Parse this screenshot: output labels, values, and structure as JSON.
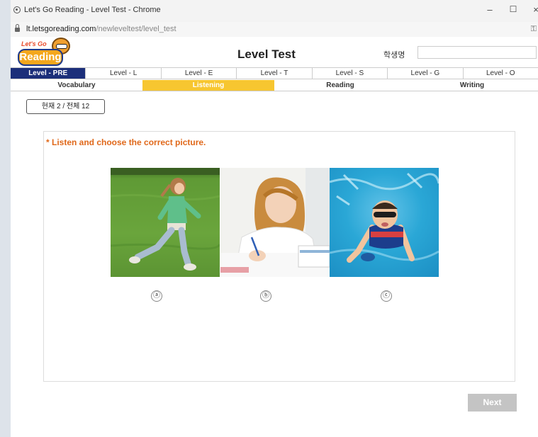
{
  "browser": {
    "window_title": "Let's Go Reading - Level Test - Chrome",
    "url_domain": "lt.letsgoreading.com",
    "url_path": "/newleveltest/level_test",
    "minimize": "–",
    "maximize": "☐",
    "close": "×"
  },
  "header": {
    "logo_top": "Let's Go",
    "logo_main": "Reading",
    "title": "Level Test",
    "student_label": "학생명",
    "student_value": ""
  },
  "levels": [
    {
      "label": "Level - PRE",
      "active": true
    },
    {
      "label": "Level - L",
      "active": false
    },
    {
      "label": "Level - E",
      "active": false
    },
    {
      "label": "Level - T",
      "active": false
    },
    {
      "label": "Level - S",
      "active": false
    },
    {
      "label": "Level - G",
      "active": false
    },
    {
      "label": "Level - O",
      "active": false
    }
  ],
  "sections": [
    {
      "label": "Vocabulary",
      "active": false
    },
    {
      "label": "Listening",
      "active": true
    },
    {
      "label": "Reading",
      "active": false
    },
    {
      "label": "Writing",
      "active": false
    }
  ],
  "progress": {
    "label": "현재 2 / 전체 12",
    "current": 2,
    "total": 12
  },
  "question": {
    "instruction": "* Listen and choose the correct picture.",
    "choices": [
      {
        "label": "ⓐ",
        "image": "girl-running-on-grass"
      },
      {
        "label": "ⓑ",
        "image": "girl-writing-at-desk"
      },
      {
        "label": "ⓒ",
        "image": "boy-swimming-underwater"
      }
    ]
  },
  "next_button": "Next",
  "colors": {
    "level_active": "#1c2f7a",
    "section_active": "#f7c630",
    "instruction": "#e0681a",
    "button_disabled": "#c4c4c4"
  }
}
